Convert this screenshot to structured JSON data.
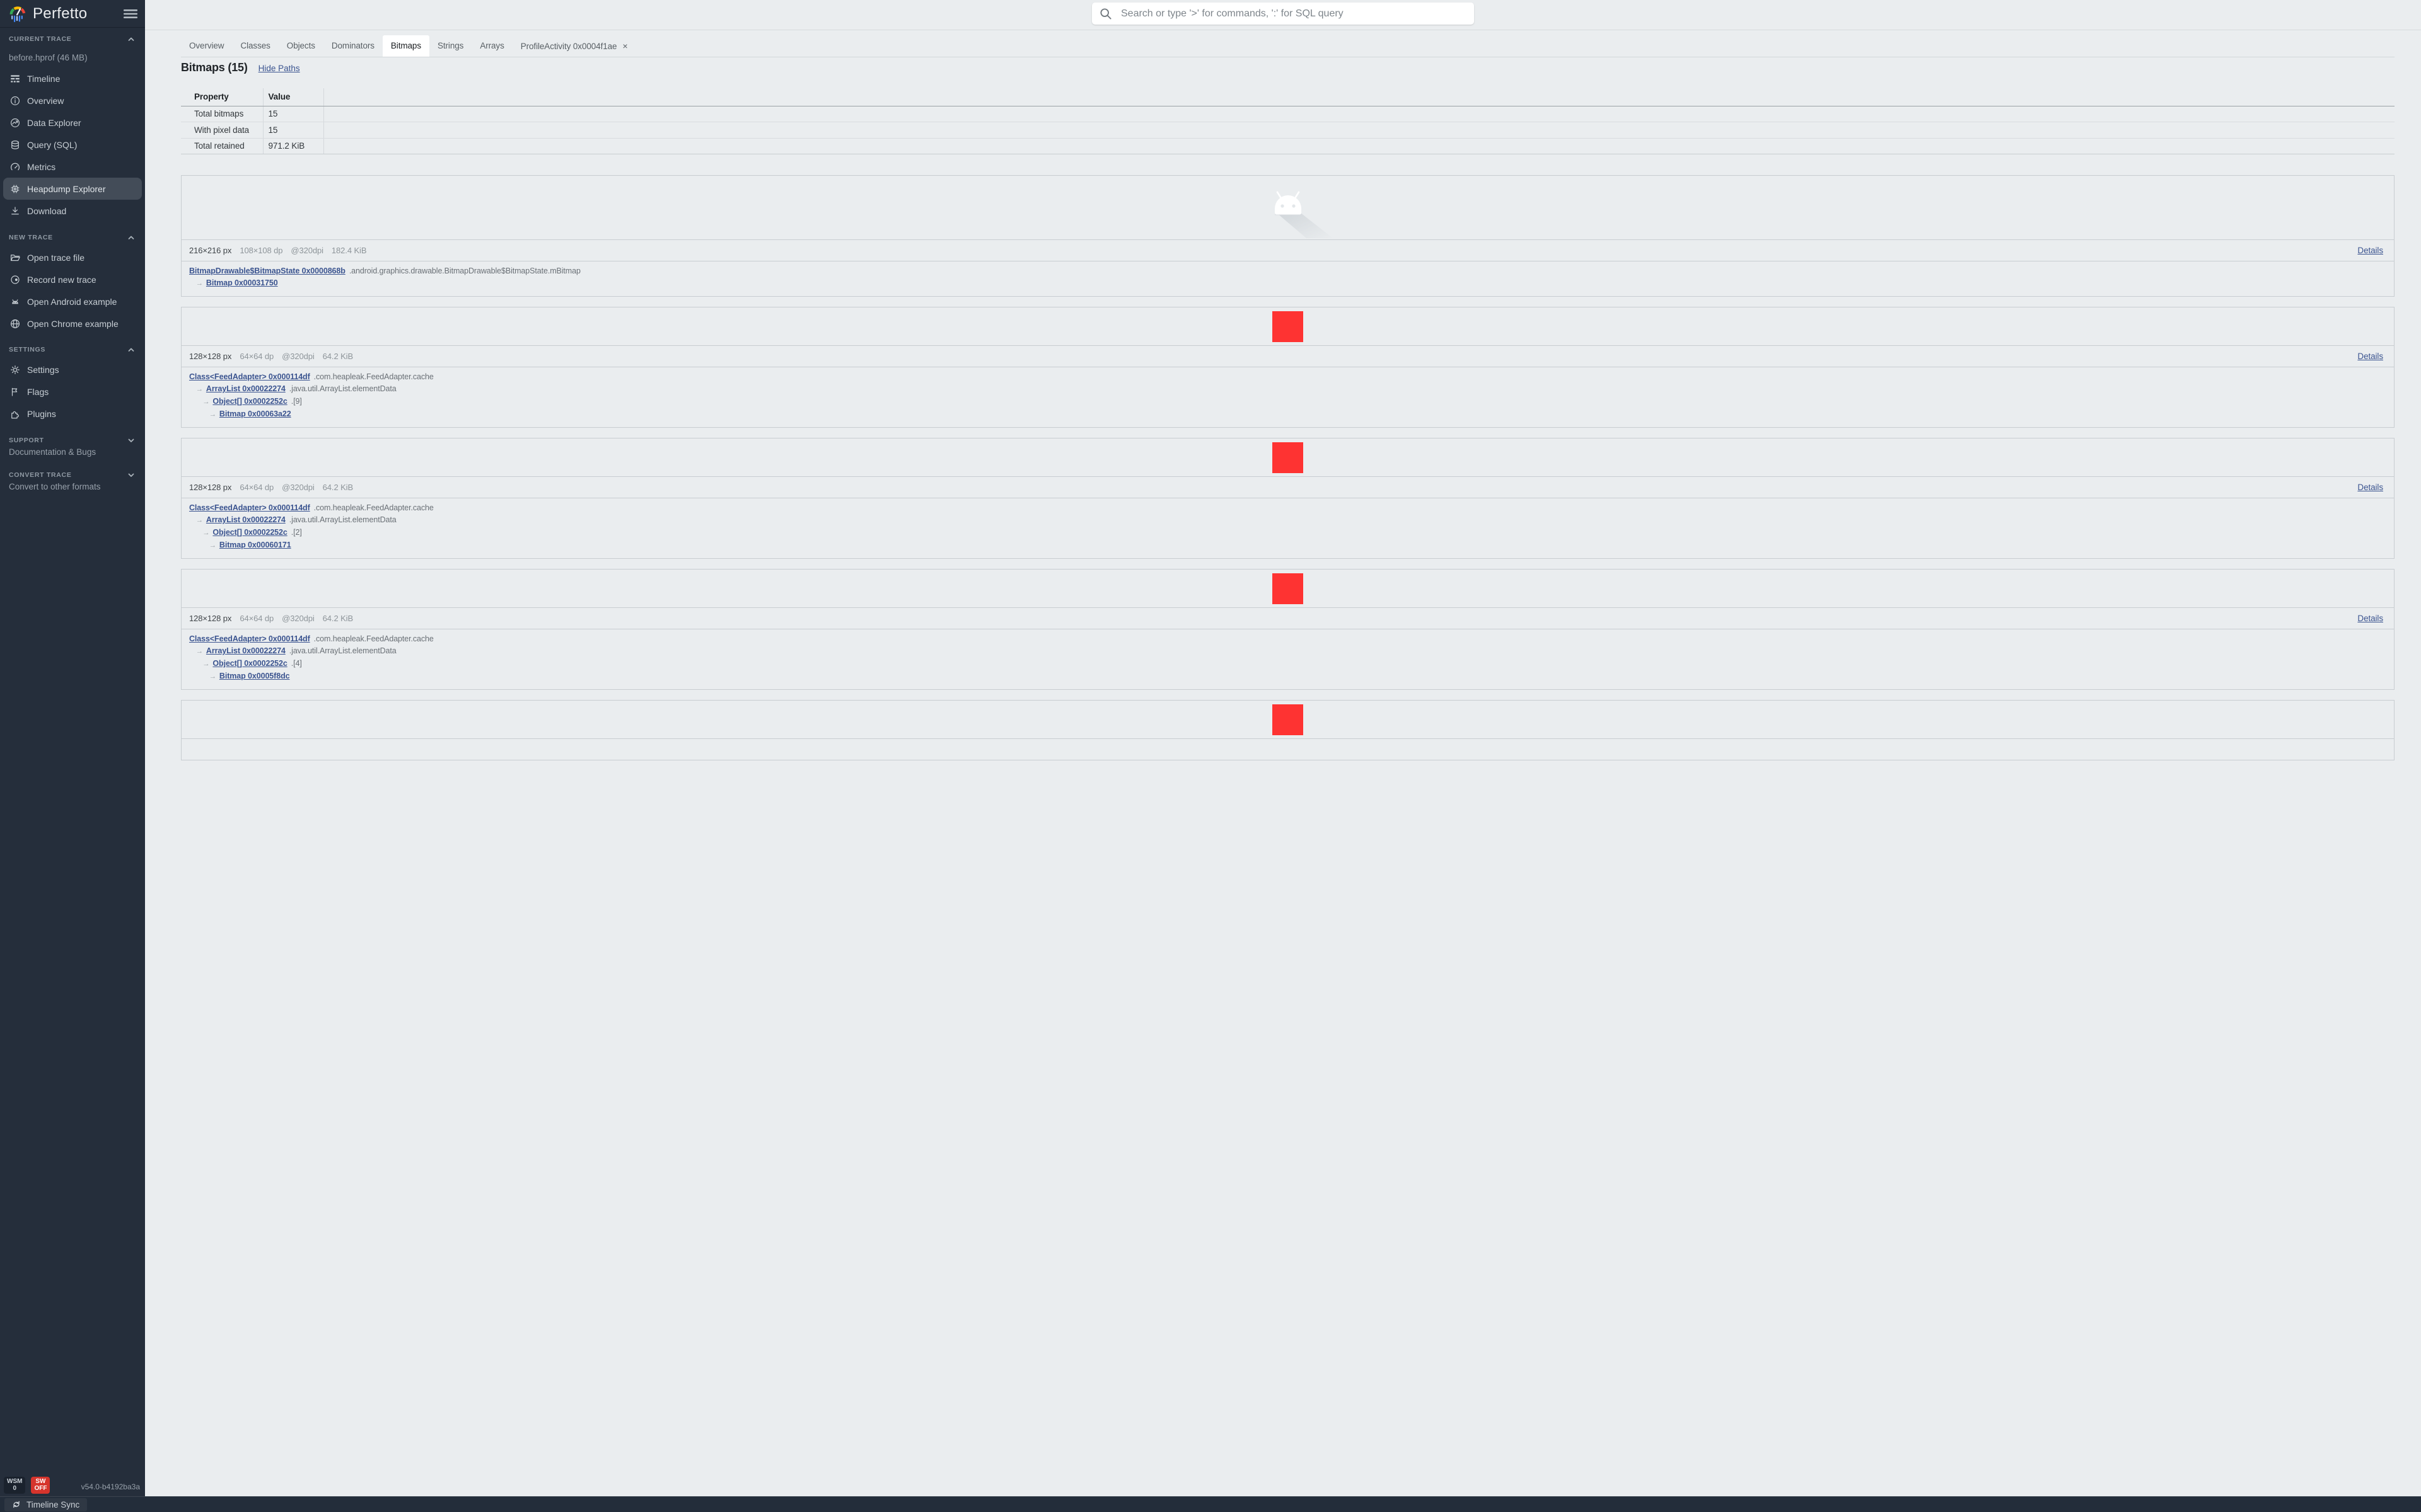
{
  "app": {
    "title": "Perfetto",
    "version": "v54.0-b4192ba3a"
  },
  "topbar": {
    "search_placeholder": "Search or type '>' for commands, ':' for SQL query"
  },
  "statusbar": {
    "sync_label": "Timeline Sync"
  },
  "footer_badges": {
    "wsm_top": "WSM",
    "wsm_bottom": "0",
    "sw_top": "SW",
    "sw_bottom": "OFF"
  },
  "glyphs": {
    "arrow": "→",
    "close": "×"
  },
  "colors": {
    "bitmap_red": "#fe3332",
    "link_blue": "#3c5590",
    "sidebar_bg": "#252e3b",
    "page_bg": "#eaedef"
  },
  "sidebar_sections": [
    {
      "id": "current-trace",
      "label": "CURRENT TRACE",
      "chevron": "up",
      "subtitle": {
        "text": "before.hprof (46 MB)",
        "interactable": false
      },
      "items": [
        {
          "icon": "timeline",
          "label": "Timeline"
        },
        {
          "icon": "info",
          "label": "Overview"
        },
        {
          "icon": "data-explorer",
          "label": "Data Explorer"
        },
        {
          "icon": "database",
          "label": "Query (SQL)"
        },
        {
          "icon": "speedometer",
          "label": "Metrics"
        },
        {
          "icon": "memory-chip",
          "label": "Heapdump Explorer",
          "active": true
        },
        {
          "icon": "download",
          "label": "Download"
        }
      ]
    },
    {
      "id": "new-trace",
      "label": "NEW TRACE",
      "chevron": "up",
      "items": [
        {
          "icon": "folder-open",
          "label": "Open trace file"
        },
        {
          "icon": "record",
          "label": "Record new trace"
        },
        {
          "icon": "android",
          "label": "Open Android example"
        },
        {
          "icon": "globe",
          "label": "Open Chrome example"
        }
      ]
    },
    {
      "id": "settings",
      "label": "SETTINGS",
      "chevron": "up",
      "items": [
        {
          "icon": "gear",
          "label": "Settings"
        },
        {
          "icon": "flag",
          "label": "Flags"
        },
        {
          "icon": "puzzle",
          "label": "Plugins"
        }
      ]
    },
    {
      "id": "support",
      "label": "SUPPORT",
      "chevron": "down",
      "subtitle": {
        "text": "Documentation & Bugs",
        "interactable": true
      },
      "items": []
    },
    {
      "id": "convert-trace",
      "label": "CONVERT TRACE",
      "chevron": "down",
      "subtitle": {
        "text": "Convert to other formats",
        "interactable": true
      },
      "items": []
    }
  ],
  "tabs": [
    {
      "label": "Overview"
    },
    {
      "label": "Classes"
    },
    {
      "label": "Objects"
    },
    {
      "label": "Dominators"
    },
    {
      "label": "Bitmaps",
      "active": true
    },
    {
      "label": "Strings"
    },
    {
      "label": "Arrays"
    },
    {
      "label": "ProfileActivity 0x0004f1ae",
      "closable": true
    }
  ],
  "page": {
    "title": "Bitmaps (15)",
    "hide_paths_label": "Hide Paths"
  },
  "summary_table": {
    "headers": [
      "Property",
      "Value"
    ],
    "rows": [
      {
        "property": "Total bitmaps",
        "value": "15"
      },
      {
        "property": "With pixel data",
        "value": "15"
      },
      {
        "property": "Total retained",
        "value": "971.2 KiB"
      }
    ]
  },
  "bitmap_cards": [
    {
      "preview": "android-robot",
      "meta": {
        "size_px": "216×216 px",
        "size_dp": "108×108 dp",
        "density": "@320dpi",
        "retained": "182.4 KiB"
      },
      "details_label": "Details",
      "paths": [
        {
          "indent": 0,
          "link": "BitmapDrawable$BitmapState 0x0000868b",
          "suffix": ".android.graphics.drawable.BitmapDrawable$BitmapState.mBitmap"
        },
        {
          "indent": 1,
          "link": "Bitmap 0x00031750",
          "suffix": ""
        }
      ]
    },
    {
      "preview": "red-square",
      "meta": {
        "size_px": "128×128 px",
        "size_dp": "64×64 dp",
        "density": "@320dpi",
        "retained": "64.2 KiB"
      },
      "details_label": "Details",
      "paths": [
        {
          "indent": 0,
          "link": "Class<FeedAdapter> 0x000114df",
          "suffix": ".com.heapleak.FeedAdapter.cache"
        },
        {
          "indent": 1,
          "link": "ArrayList 0x00022274",
          "suffix": ".java.util.ArrayList.elementData"
        },
        {
          "indent": 2,
          "link": "Object[] 0x0002252c",
          "suffix": ".[9]"
        },
        {
          "indent": 3,
          "link": "Bitmap 0x00063a22",
          "suffix": ""
        }
      ]
    },
    {
      "preview": "red-square",
      "meta": {
        "size_px": "128×128 px",
        "size_dp": "64×64 dp",
        "density": "@320dpi",
        "retained": "64.2 KiB"
      },
      "details_label": "Details",
      "paths": [
        {
          "indent": 0,
          "link": "Class<FeedAdapter> 0x000114df",
          "suffix": ".com.heapleak.FeedAdapter.cache"
        },
        {
          "indent": 1,
          "link": "ArrayList 0x00022274",
          "suffix": ".java.util.ArrayList.elementData"
        },
        {
          "indent": 2,
          "link": "Object[] 0x0002252c",
          "suffix": ".[2]"
        },
        {
          "indent": 3,
          "link": "Bitmap 0x00060171",
          "suffix": ""
        }
      ]
    },
    {
      "preview": "red-square",
      "meta": {
        "size_px": "128×128 px",
        "size_dp": "64×64 dp",
        "density": "@320dpi",
        "retained": "64.2 KiB"
      },
      "details_label": "Details",
      "paths": [
        {
          "indent": 0,
          "link": "Class<FeedAdapter> 0x000114df",
          "suffix": ".com.heapleak.FeedAdapter.cache"
        },
        {
          "indent": 1,
          "link": "ArrayList 0x00022274",
          "suffix": ".java.util.ArrayList.elementData"
        },
        {
          "indent": 2,
          "link": "Object[] 0x0002252c",
          "suffix": ".[4]"
        },
        {
          "indent": 3,
          "link": "Bitmap 0x0005f8dc",
          "suffix": ""
        }
      ]
    },
    {
      "preview": "red-square",
      "partial": true
    }
  ]
}
